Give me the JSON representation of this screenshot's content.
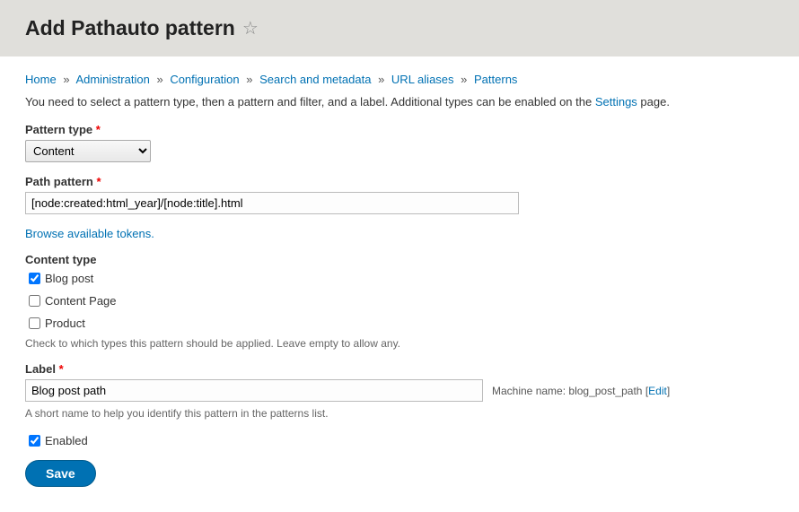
{
  "header": {
    "title": "Add Pathauto pattern"
  },
  "breadcrumb": {
    "items": [
      "Home",
      "Administration",
      "Configuration",
      "Search and metadata",
      "URL aliases",
      "Patterns"
    ]
  },
  "intro": {
    "text_before": "You need to select a pattern type, then a pattern and filter, and a label. Additional types can be enabled on the ",
    "link": "Settings",
    "text_after": " page."
  },
  "form": {
    "pattern_type": {
      "label": "Pattern type",
      "value": "Content"
    },
    "path_pattern": {
      "label": "Path pattern",
      "value": "[node:created:html_year]/[node:title].html"
    },
    "tokens_link": "Browse available tokens.",
    "content_type": {
      "label": "Content type",
      "options": [
        {
          "label": "Blog post",
          "checked": true
        },
        {
          "label": "Content Page",
          "checked": false
        },
        {
          "label": "Product",
          "checked": false
        }
      ],
      "help": "Check to which types this pattern should be applied. Leave empty to allow any."
    },
    "label_field": {
      "label": "Label",
      "value": "Blog post path",
      "help": "A short name to help you identify this pattern in the patterns list.",
      "machine_name_prefix": "Machine name: ",
      "machine_name": "blog_post_path",
      "edit": "Edit"
    },
    "enabled": {
      "label": "Enabled",
      "checked": true
    },
    "save": "Save"
  }
}
